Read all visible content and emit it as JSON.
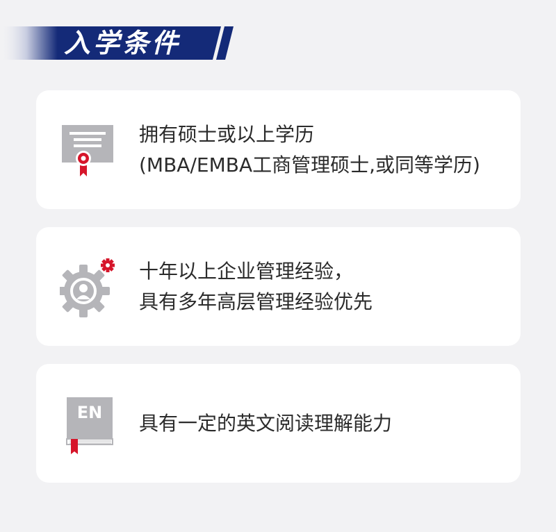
{
  "header": {
    "title": "入学条件"
  },
  "colors": {
    "banner_navy": "#142a78",
    "accent_red": "#d6152a",
    "icon_gray": "#b5b5b9",
    "card_bg": "#ffffff",
    "page_bg": "#f2f2f4",
    "text": "#2b2b2b"
  },
  "cards": [
    {
      "icon": "certificate-icon",
      "lines": [
        "拥有硕士或以上学历",
        "(MBA/EMBA工商管理硕士,或同等学历)"
      ]
    },
    {
      "icon": "manager-gear-icon",
      "lines": [
        "十年以上企业管理经验，",
        "具有多年高层管理经验优先"
      ]
    },
    {
      "icon": "english-book-icon",
      "badge": "EN",
      "lines": [
        "具有一定的英文阅读理解能力"
      ]
    }
  ]
}
